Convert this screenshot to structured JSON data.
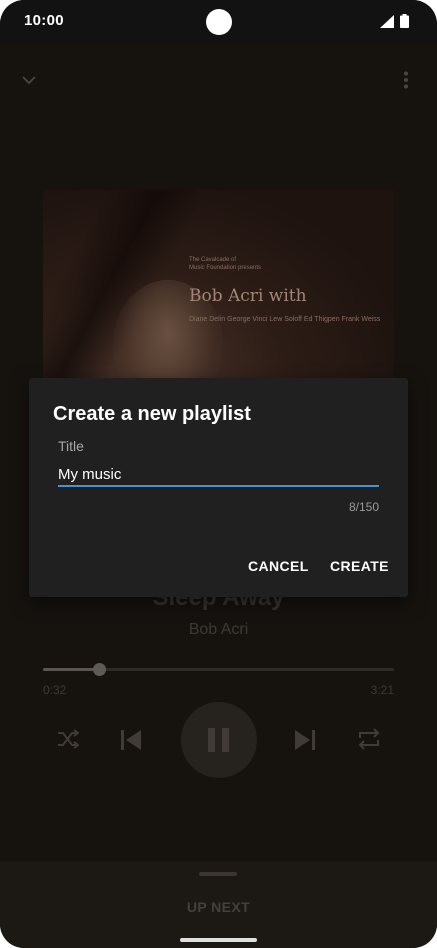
{
  "status_bar": {
    "time": "10:00"
  },
  "player": {
    "album_art": {
      "small_line_1": "The Cavalcade of",
      "small_line_2": "Music Foundation presents",
      "title": "Bob Acri with",
      "names": "Diane Delin  George Vinci  Lew Soloff  Ed Thigpen  Frank Weiss"
    },
    "track_title": "Sleep Away",
    "track_artist": "Bob Acri",
    "time_elapsed": "0:32",
    "time_total": "3:21",
    "progress": 0.16
  },
  "up_next": {
    "label": "UP NEXT"
  },
  "dialog": {
    "title": "Create a new playlist",
    "field_label": "Title",
    "field_value": "My music",
    "char_counter": "8/150",
    "cancel_label": "CANCEL",
    "create_label": "CREATE"
  },
  "colors": {
    "accent_underline": "#4b8fd6",
    "dialog_bg": "#202020",
    "background": "#16130f"
  },
  "icons": [
    "chevron-down-icon",
    "more-vert-icon",
    "shuffle-icon",
    "skip-previous-icon",
    "pause-icon",
    "skip-next-icon",
    "repeat-icon",
    "signal-icon",
    "battery-icon"
  ]
}
